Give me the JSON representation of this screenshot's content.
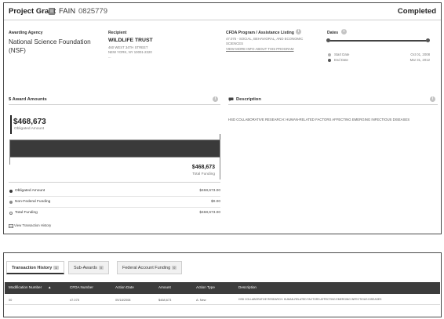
{
  "header": {
    "award_type": "Project Grant",
    "fain_label": "FAIN",
    "fain_value": "0825779",
    "status": "Completed"
  },
  "awarding_agency": {
    "label": "Awarding Agency",
    "name": "National Science Foundation (NSF)"
  },
  "recipient": {
    "label": "Recipient",
    "name": "WILDLIFE TRUST",
    "address_line1": "460 WEST 34TH STREET",
    "address_line2": "NEW YORK, NY 10001-2320",
    "address_line3": "..."
  },
  "cfda": {
    "label": "CFDA Program / Assistance Listing",
    "program_line1": "47.075 - SOCIAL, BEHAVIORAL, AND ECONOMIC",
    "program_line2": "SCIENCES",
    "link_text": "VIEW MORE INFO ABOUT THIS PROGRAM"
  },
  "dates": {
    "label": "Dates",
    "start_label": "Start Date",
    "start_value": "Oct 01, 2008",
    "end_label": "End Date",
    "end_value": "Mar 31, 2012",
    "progress_fraction": 1.0
  },
  "award_amounts": {
    "title": "$ Award Amounts",
    "obligated_value": "$468,673",
    "obligated_label": "Obligated Amount",
    "total_value": "$468,673",
    "total_label": "Total Funding",
    "legend": [
      {
        "name": "Obligated Amount",
        "value": "$468,673.00",
        "color": "#3a3a3a"
      },
      {
        "name": "Non-Federal Funding",
        "value": "$0.00",
        "color": "#8a8a8a"
      },
      {
        "name": "Total Funding",
        "value": "$468,673.00",
        "color": "#ffffff"
      }
    ],
    "history_link": "View Transaction History"
  },
  "description": {
    "title": "Description",
    "text": "HSD COLLABORATIVE RESEARCH: HUMAN-RELATED FACTORS AFFECTING EMERGING INFECTIOUS DISEASES"
  },
  "tabs": [
    {
      "label": "Transaction History",
      "count": "1"
    },
    {
      "label": "Sub-Awards",
      "count": "0"
    },
    {
      "label": "Federal Account Funding",
      "count": "0"
    }
  ],
  "table": {
    "columns": [
      "Modification Number",
      "CFDA Number",
      "Action Date",
      "Amount",
      "Action Type",
      "Description"
    ],
    "rows": [
      [
        "00",
        "47.075",
        "09/18/2008",
        "$468,673",
        "A: New",
        "HSD COLLABORATIVE RESEARCH: HUMAN-RELATED FACTORS AFFECTING EMERGING INFECTIOUS DISEASES"
      ]
    ]
  },
  "colors": {
    "border": "#4a4a4a",
    "bar_dark": "#3a3a3a",
    "table_header": "#3c3c3c"
  }
}
